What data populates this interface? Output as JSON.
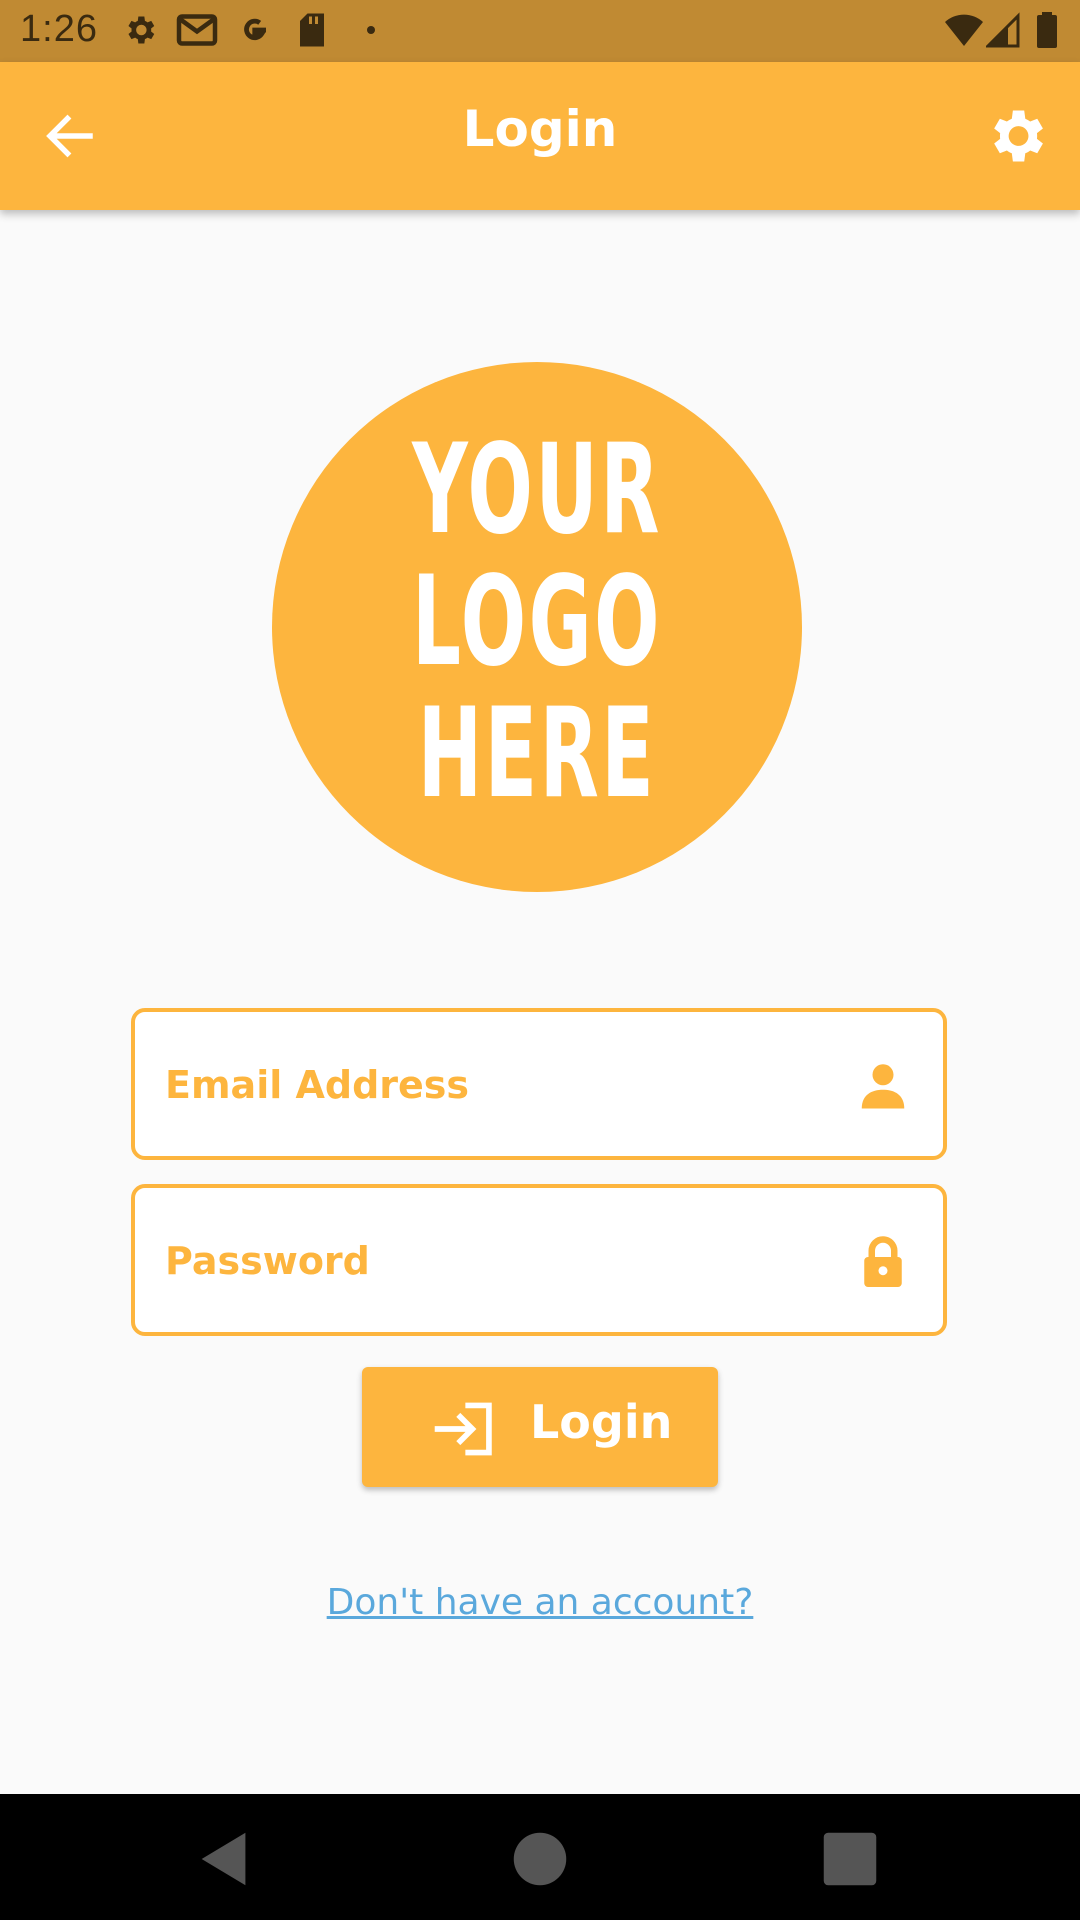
{
  "status_bar": {
    "time": "1:26",
    "left_icons": [
      "gear-icon",
      "gmail-icon",
      "google-icon",
      "sd-card-icon",
      "dot-icon"
    ],
    "right_icons": [
      "wifi-icon",
      "signal-icon",
      "battery-icon"
    ]
  },
  "app_bar": {
    "title": "Login",
    "back_icon": "arrow-left-icon",
    "settings_icon": "gear-icon",
    "background_color": "#fdb53e"
  },
  "logo": {
    "lines": [
      "YOUR",
      "LOGO",
      "HERE"
    ],
    "color": "#fdb53e"
  },
  "form": {
    "email": {
      "placeholder": "Email Address",
      "value": "",
      "icon": "person-icon"
    },
    "password": {
      "placeholder": "Password",
      "value": "",
      "icon": "lock-icon"
    },
    "login_button": {
      "label": "Login",
      "icon": "login-arrow-icon"
    },
    "signup_link": "Don't have an account?"
  },
  "nav_bar": {
    "buttons": [
      "back-triangle-icon",
      "home-circle-icon",
      "recents-square-icon"
    ]
  },
  "colors": {
    "accent": "#fdb53e",
    "status_bar": "#c08a33",
    "link": "#5aa8dc"
  }
}
